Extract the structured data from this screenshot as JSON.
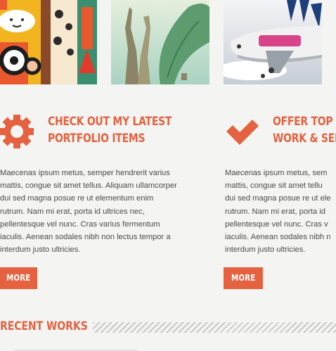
{
  "thumbnails": [
    {
      "name": "illustration-thumbnail"
    },
    {
      "name": "giraffe-thumbnail"
    },
    {
      "name": "airplane-thumbnail"
    }
  ],
  "features": [
    {
      "icon": "gear-icon",
      "title_lines": [
        "Check out my latest",
        "portfolio items"
      ],
      "body_lines": [
        "Maecenas ipsum metus, semper hendrerit varius",
        "mattis, congue sit amet tellus. Aliquam ullamcorper",
        "dui sed magna posue re ut elementum enim",
        "rutrum. Nam mi erat, porta id ultrices nec,",
        "pellentesque vel nunc. Cras varius fermentum",
        "iaculis. Aenean sodales nibh non lectus tempor a",
        "interdum justo ultricies."
      ],
      "button": "MORE"
    },
    {
      "icon": "checkmark-icon",
      "title_lines": [
        "Offer top n",
        "work & ser"
      ],
      "body_lines": [
        "Maecenas ipsum metus, sem",
        "mattis, congue sit amet tellu",
        "dui sed magna posue re ut ele",
        "rutrum. Nam mi erat, porta id",
        "pellentesque vel nunc. Cras v",
        "iaculis. Aenean sodales nibh n",
        "interdum justo ultricies."
      ],
      "button": "MORE"
    }
  ],
  "recent_works": {
    "title": "RECENT WORKS"
  },
  "colors": {
    "accent": "#e4623f",
    "text": "#4a4a4a",
    "background": "#f4f4f3"
  }
}
